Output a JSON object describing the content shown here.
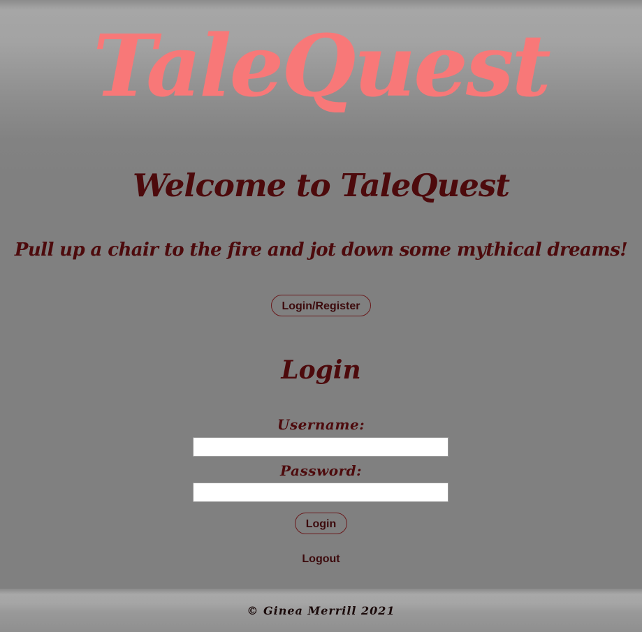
{
  "header": {
    "brand": "TaleQuest"
  },
  "main": {
    "welcome_heading": "Welcome to TaleQuest",
    "tagline": "Pull up a chair to the fire and jot down some mythical dreams!",
    "nav_login_register_label": "Login/Register"
  },
  "login_form": {
    "heading": "Login",
    "username_label": "Username:",
    "username_value": "",
    "password_label": "Password:",
    "password_value": "",
    "submit_label": "Login",
    "logout_label": "Logout"
  },
  "footer": {
    "copyright": "© Ginea Merrill 2021"
  },
  "colors": {
    "brand": "#f87878",
    "heading_text": "#4d0a0c",
    "button_border": "#6a1a1c",
    "background": "#808080"
  }
}
